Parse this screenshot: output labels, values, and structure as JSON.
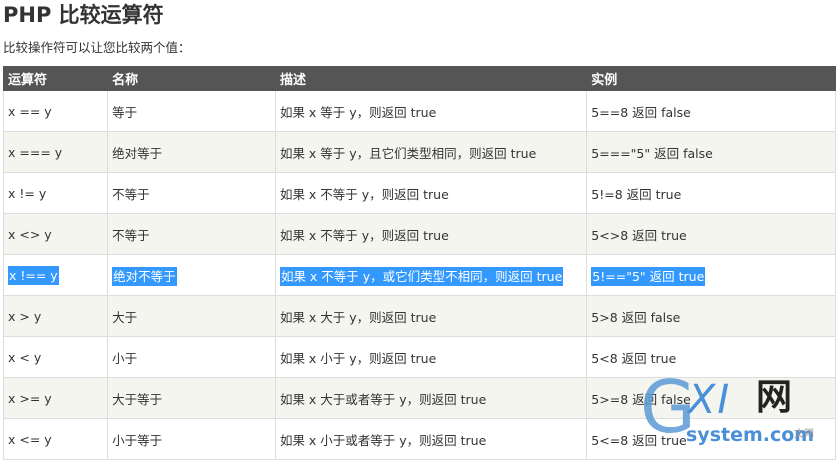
{
  "page": {
    "title": "PHP 比较运算符",
    "intro": "比较操作符可以让您比较两个值："
  },
  "table": {
    "headers": [
      "运算符",
      "名称",
      "描述",
      "实例"
    ],
    "rows": [
      {
        "op": "x == y",
        "name": "等于",
        "desc": "如果 x 等于 y，则返回 true",
        "example": "5==8 返回 false"
      },
      {
        "op": "x === y",
        "name": "绝对等于",
        "desc": "如果 x 等于 y，且它们类型相同，则返回 true",
        "example": "5===\"5\" 返回 false"
      },
      {
        "op": "x != y",
        "name": "不等于",
        "desc": "如果 x 不等于 y，则返回 true",
        "example": "5!=8 返回 true"
      },
      {
        "op": "x <> y",
        "name": "不等于",
        "desc": "如果 x 不等于 y，则返回 true",
        "example": "5<>8 返回 true"
      },
      {
        "op": "x !== y",
        "name": "绝对不等于",
        "desc": "如果 x 不等于 y，或它们类型不相同，则返回 true",
        "example": "5!==\"5\" 返回 true",
        "selected": true
      },
      {
        "op": "x > y",
        "name": "大于",
        "desc": "如果 x 大于 y，则返回 true",
        "example": "5>8 返回 false"
      },
      {
        "op": "x < y",
        "name": "小于",
        "desc": "如果 x 小于 y，则返回 true",
        "example": "5<8 返回 true"
      },
      {
        "op": "x >= y",
        "name": "大于等于",
        "desc": "如果 x 大于或者等于 y，则返回 true",
        "example": "5>=8 返回 false"
      },
      {
        "op": "x <= y",
        "name": "小于等于",
        "desc": "如果 x 小于或者等于 y，则返回 true",
        "example": "5<=8 返回 true"
      }
    ]
  },
  "watermark": {
    "logo_g": "G",
    "logo_xi": "XI",
    "logo_cn": "网",
    "site": "system.com",
    "sub": "文网"
  },
  "colors": {
    "header_bg": "#555555",
    "row_alt_bg": "#f5f5f0",
    "selection": "#3399ff",
    "watermark_blue": "#4a90d9"
  }
}
